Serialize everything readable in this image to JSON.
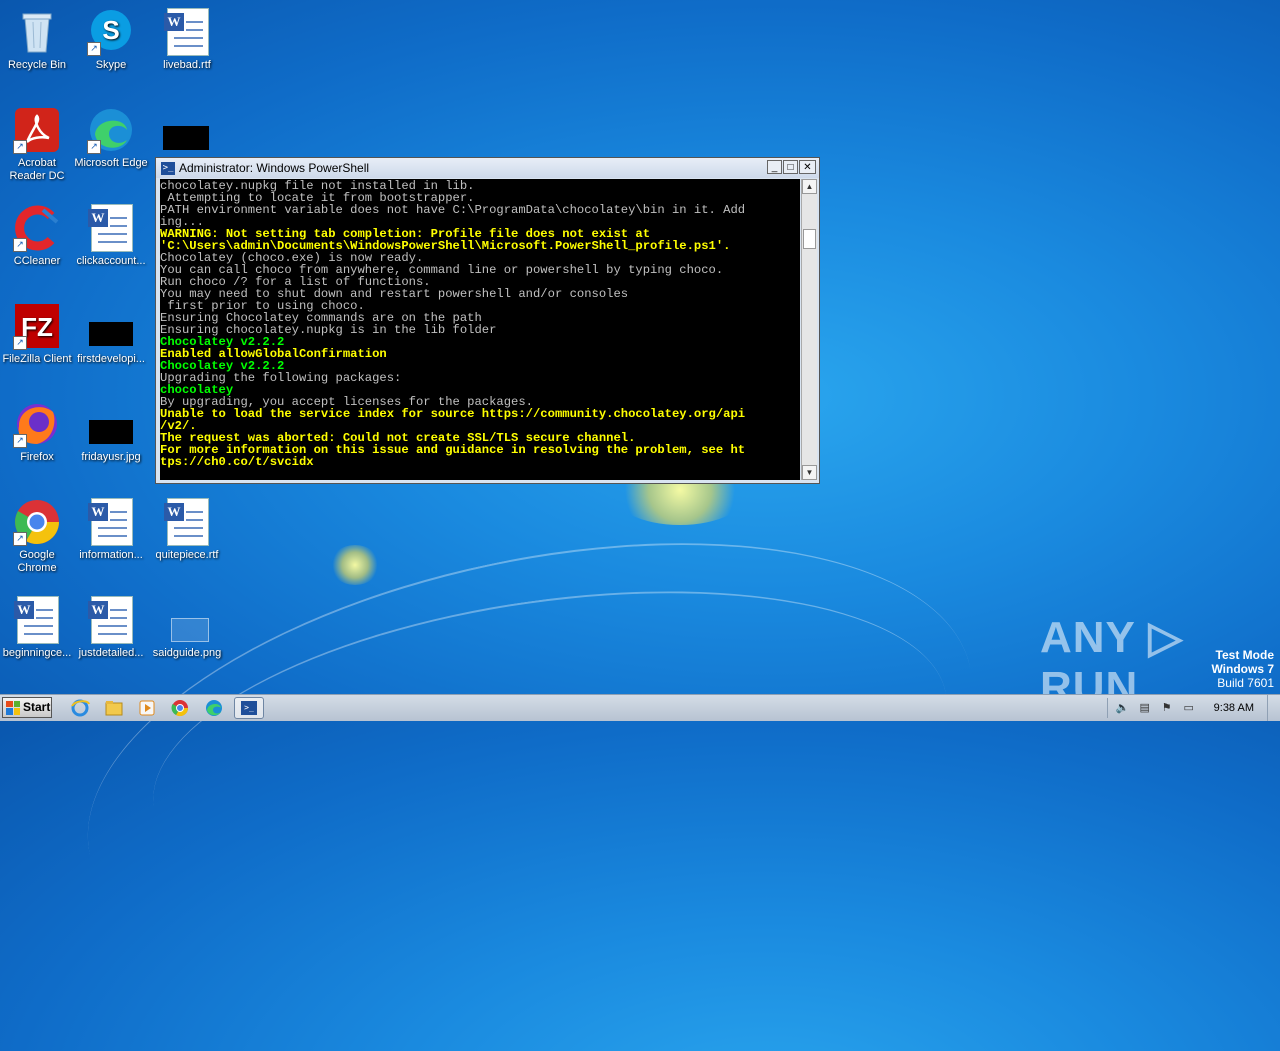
{
  "desktop": {
    "icons": [
      {
        "label": "Recycle Bin"
      },
      {
        "label": "Skype"
      },
      {
        "label": "livebad.rtf"
      },
      {
        "label": "Acrobat Reader DC"
      },
      {
        "label": "Microsoft Edge"
      },
      {
        "label": "CCleaner"
      },
      {
        "label": "clickaccount..."
      },
      {
        "label": "FileZilla Client"
      },
      {
        "label": "firstdevelopi..."
      },
      {
        "label": "Firefox"
      },
      {
        "label": "fridayusr.jpg"
      },
      {
        "label": "Google Chrome"
      },
      {
        "label": "information..."
      },
      {
        "label": "quitepiece.rtf"
      },
      {
        "label": "beginningce..."
      },
      {
        "label": "justdetailed..."
      },
      {
        "label": "saidguide.png"
      }
    ]
  },
  "window": {
    "title": "Administrator: Windows PowerShell",
    "buttons": {
      "minimize": "_",
      "maximize": "□",
      "close": "✕"
    },
    "console_lines": [
      {
        "text": "chocolatey.nupkg file not installed in lib.",
        "color": "white"
      },
      {
        "text": " Attempting to locate it from bootstrapper.",
        "color": "white"
      },
      {
        "text": "PATH environment variable does not have C:\\ProgramData\\chocolatey\\bin in it. Add",
        "color": "white"
      },
      {
        "text": "ing...",
        "color": "white"
      },
      {
        "text": "WARNING: Not setting tab completion: Profile file does not exist at",
        "color": "yellow"
      },
      {
        "text": "'C:\\Users\\admin\\Documents\\WindowsPowerShell\\Microsoft.PowerShell_profile.ps1'.",
        "color": "yellow"
      },
      {
        "text": "Chocolatey (choco.exe) is now ready.",
        "color": "white"
      },
      {
        "text": "You can call choco from anywhere, command line or powershell by typing choco.",
        "color": "white"
      },
      {
        "text": "Run choco /? for a list of functions.",
        "color": "white"
      },
      {
        "text": "You may need to shut down and restart powershell and/or consoles",
        "color": "white"
      },
      {
        "text": " first prior to using choco.",
        "color": "white"
      },
      {
        "text": "Ensuring Chocolatey commands are on the path",
        "color": "white"
      },
      {
        "text": "Ensuring chocolatey.nupkg is in the lib folder",
        "color": "white"
      },
      {
        "text": "Chocolatey v2.2.2",
        "color": "green"
      },
      {
        "text": "Enabled allowGlobalConfirmation",
        "color": "yellow"
      },
      {
        "text": "Chocolatey v2.2.2",
        "color": "green"
      },
      {
        "text": "Upgrading the following packages:",
        "color": "white"
      },
      {
        "text": "chocolatey",
        "color": "green"
      },
      {
        "text": "By upgrading, you accept licenses for the packages.",
        "color": "white"
      },
      {
        "text": "Unable to load the service index for source https://community.chocolatey.org/api",
        "color": "yellow"
      },
      {
        "text": "/v2/.",
        "color": "yellow"
      },
      {
        "text": "The request was aborted: Could not create SSL/TLS secure channel.",
        "color": "yellow"
      },
      {
        "text": "For more information on this issue and guidance in resolving the problem, see ht",
        "color": "yellow"
      },
      {
        "text": "tps://ch0.co/t/svcidx",
        "color": "yellow"
      }
    ]
  },
  "watermark": {
    "text": "ANY ▷ RUN"
  },
  "test_mode": {
    "line1": "Test Mode",
    "line2": "Windows 7",
    "line3": "Build 7601"
  },
  "taskbar": {
    "start_label": "Start",
    "clock": "9:38 AM"
  },
  "colors": {
    "console_bg": "#000000",
    "console_yellow": "#ffff00",
    "console_green": "#00ff00"
  }
}
